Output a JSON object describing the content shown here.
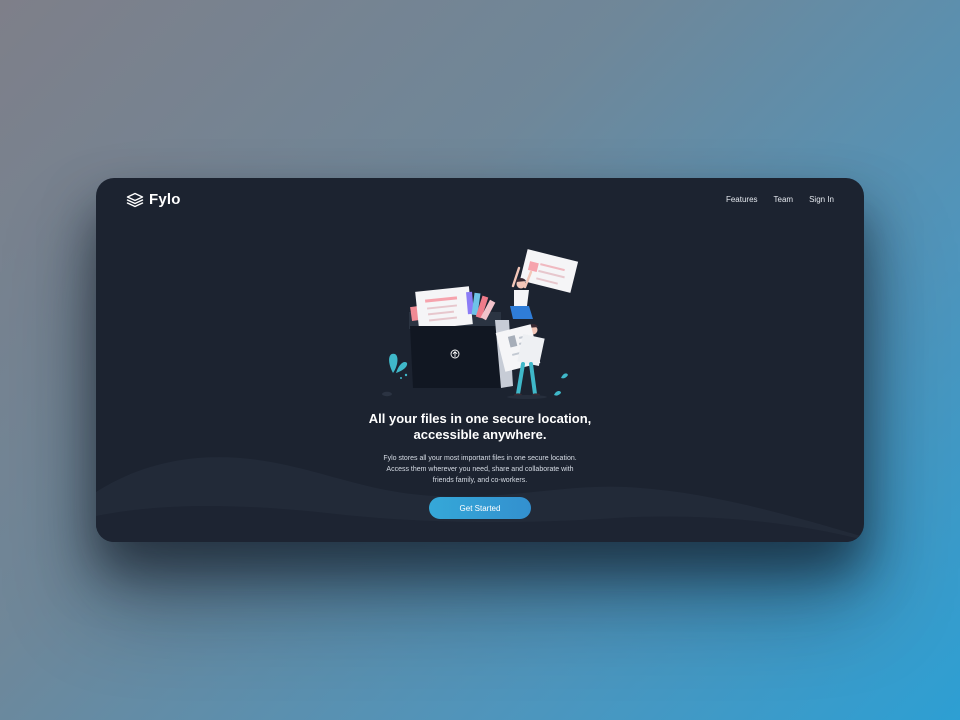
{
  "brand": {
    "name": "Fylo",
    "logo_icon": "stacked-layers-icon"
  },
  "nav": {
    "items": [
      "Features",
      "Team",
      "Sign In"
    ]
  },
  "hero": {
    "illustration": "people-with-files-folder-illustration",
    "upload_icon": "upload-arrow-icon",
    "headline_lines": [
      "All your files in one secure location,",
      "accessible anywhere."
    ],
    "description_lines": [
      "Fylo stores all your most important files in one secure location.",
      "Access them wherever you need, share and collaborate with",
      "friends family, and co-workers."
    ],
    "cta_label": "Get Started"
  },
  "colors": {
    "page_gradient_start": "#7e7f89",
    "page_gradient_end": "#2d9fd3",
    "card_background": "#1c2330",
    "wave_background": "#222a38",
    "cta_gradient_start": "#35a8d8",
    "cta_gradient_end": "#3390cf",
    "text_primary": "#ffffff"
  }
}
